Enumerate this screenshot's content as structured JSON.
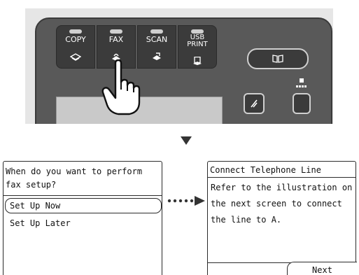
{
  "device": {
    "function_keys": [
      {
        "label": "COPY",
        "icon": "copy-icon"
      },
      {
        "label": "FAX",
        "icon": "fax-icon"
      },
      {
        "label": "SCAN",
        "icon": "scan-icon"
      },
      {
        "label": "USB PRINT",
        "label_line1": "USB",
        "label_line2": "PRINT",
        "icon": "usb-print-icon"
      }
    ],
    "book_button_icon": "book-icon",
    "stop_button_icon": "stop-icon",
    "indicator_icon": "dots-indicator-icon",
    "panel_color": "#595959",
    "key_color": "#3b3b3b"
  },
  "screen_left": {
    "question": "When do you want to perform fax setup?",
    "options": [
      {
        "label": "Set Up Now",
        "selected": true
      },
      {
        "label": "Set Up Later",
        "selected": false
      }
    ]
  },
  "screen_right": {
    "title": "Connect Telephone Line",
    "body": "Refer to the illustration on the next screen to connect the line to A.",
    "next_button": "Next"
  }
}
